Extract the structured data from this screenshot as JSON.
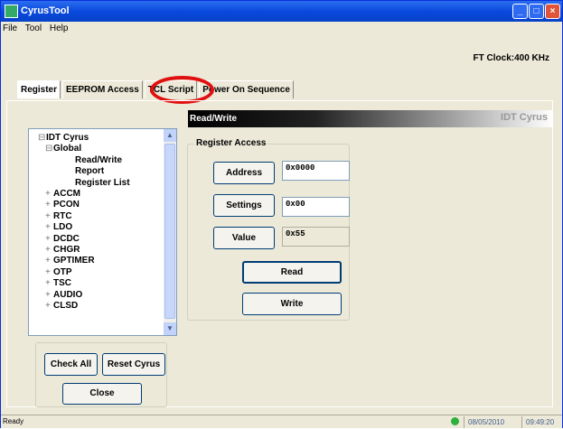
{
  "window": {
    "title": "CyrusTool"
  },
  "menu": [
    "File",
    "Tool",
    "Help"
  ],
  "clock": "FT Clock:400 KHz",
  "tabs": [
    "Register",
    "EEPROM Access",
    "TCL Script",
    "Power On Sequence"
  ],
  "section_header": "Read/Write",
  "section_brand": "IDT Cyrus",
  "tree": [
    {
      "label": "IDT Cyrus",
      "prefix": "⊟"
    },
    {
      "label": "Global",
      "prefix": "⊟"
    },
    {
      "label": "Read/Write",
      "prefix": ""
    },
    {
      "label": "Report",
      "prefix": ""
    },
    {
      "label": "Register List",
      "prefix": ""
    },
    {
      "label": "ACCM",
      "prefix": "+"
    },
    {
      "label": "PCON",
      "prefix": "+"
    },
    {
      "label": "RTC",
      "prefix": "+"
    },
    {
      "label": "LDO",
      "prefix": "+"
    },
    {
      "label": "DCDC",
      "prefix": "+"
    },
    {
      "label": "CHGR",
      "prefix": "+"
    },
    {
      "label": "GPTIMER",
      "prefix": "+"
    },
    {
      "label": "OTP",
      "prefix": "+"
    },
    {
      "label": "TSC",
      "prefix": "+"
    },
    {
      "label": "AUDIO",
      "prefix": "+"
    },
    {
      "label": "CLSD",
      "prefix": "+"
    }
  ],
  "register_access": {
    "title": "Register Access",
    "address_label": "Address",
    "address_value": "0x0000",
    "settings_label": "Settings",
    "settings_value": "0x00",
    "value_label": "Value",
    "value_value": "0x55",
    "read_label": "Read",
    "write_label": "Write"
  },
  "bottom_buttons": {
    "check_all": "Check All",
    "reset": "Reset Cyrus",
    "close": "Close"
  },
  "status": {
    "text": "Ready",
    "date": "08/05/2010",
    "time": "09:49:20"
  }
}
